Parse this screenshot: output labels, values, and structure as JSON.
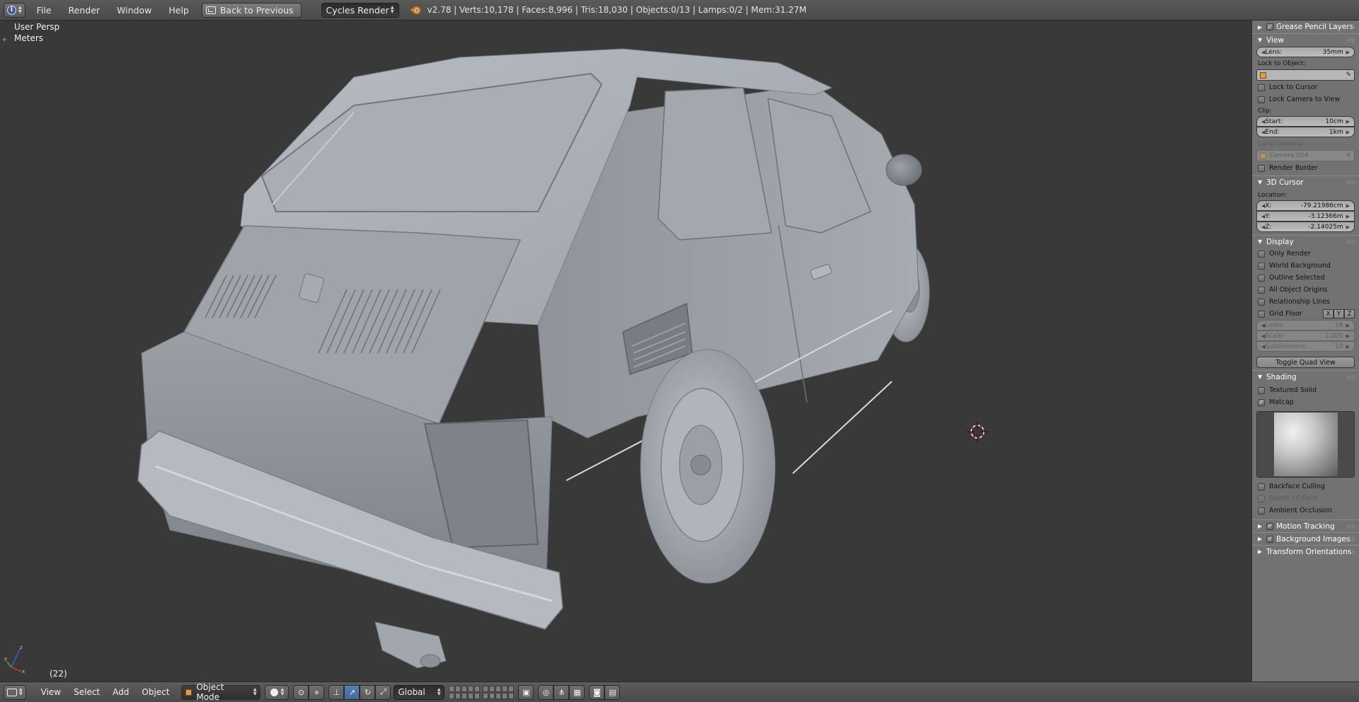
{
  "topbar": {
    "menus": [
      "File",
      "Render",
      "Window",
      "Help"
    ],
    "back_label": "Back to Previous",
    "render_engine": "Cycles Render",
    "stats": "v2.78 | Verts:10,178 | Faces:8,996 | Tris:18,030 | Objects:0/13 | Lamps:0/2 | Mem:31.27M"
  },
  "viewport": {
    "view_label": "User Persp",
    "units_label": "Meters",
    "frame": "(22)"
  },
  "properties": {
    "grease_pencil": {
      "title": "Grease Pencil Layers",
      "checked": true
    },
    "view": {
      "title": "View",
      "lens_label": "Lens:",
      "lens_value": "35mm",
      "lock_to_object_label": "Lock to Object:",
      "lock_to_cursor": "Lock to Cursor",
      "lock_camera": "Lock Camera to View",
      "clip_label": "Clip:",
      "clip_start_label": "Start:",
      "clip_start_value": "10cm",
      "clip_end_label": "End:",
      "clip_end_value": "1km",
      "local_camera_label": "Local Camera:",
      "local_camera_value": "Camera.004",
      "render_border": "Render Border"
    },
    "cursor": {
      "title": "3D Cursor",
      "location_label": "Location:",
      "x_label": "X:",
      "x_value": "-79.21986cm",
      "y_label": "Y:",
      "y_value": "-3.12366m",
      "z_label": "Z:",
      "z_value": "-2.14025m"
    },
    "display": {
      "title": "Display",
      "only_render": "Only Render",
      "world_background": "World Background",
      "outline_selected": "Outline Selected",
      "all_object_origins": "All Object Origins",
      "relationship_lines": "Relationship Lines",
      "grid_floor": "Grid Floor",
      "axes": [
        "X",
        "Y",
        "Z"
      ],
      "lines_label": "Lines:",
      "lines_value": "16",
      "scale_label": "Scale:",
      "scale_value": "1.000",
      "subdivisions_label": "Subdivisions:",
      "subdivisions_value": "10",
      "toggle_quad": "Toggle Quad View"
    },
    "shading": {
      "title": "Shading",
      "textured_solid": "Textured Solid",
      "matcap": "Matcap",
      "matcap_checked": true,
      "backface_culling": "Backface Culling",
      "depth_of_field": "Depth Of Field",
      "ambient_occlusion": "Ambient Occlusion"
    },
    "motion_tracking": {
      "title": "Motion Tracking",
      "checked": true
    },
    "background_images": {
      "title": "Background Images",
      "checked": true
    },
    "transform_orientations": {
      "title": "Transform Orientations"
    }
  },
  "bottombar": {
    "menus": [
      "View",
      "Select",
      "Add",
      "Object"
    ],
    "mode": "Object Mode",
    "orientation": "Global"
  },
  "colors": {
    "viewport_bg": "#393939",
    "panel_bg": "#727272",
    "header_bg": "#4f4f4f",
    "active_blue": "#4d74a8"
  }
}
